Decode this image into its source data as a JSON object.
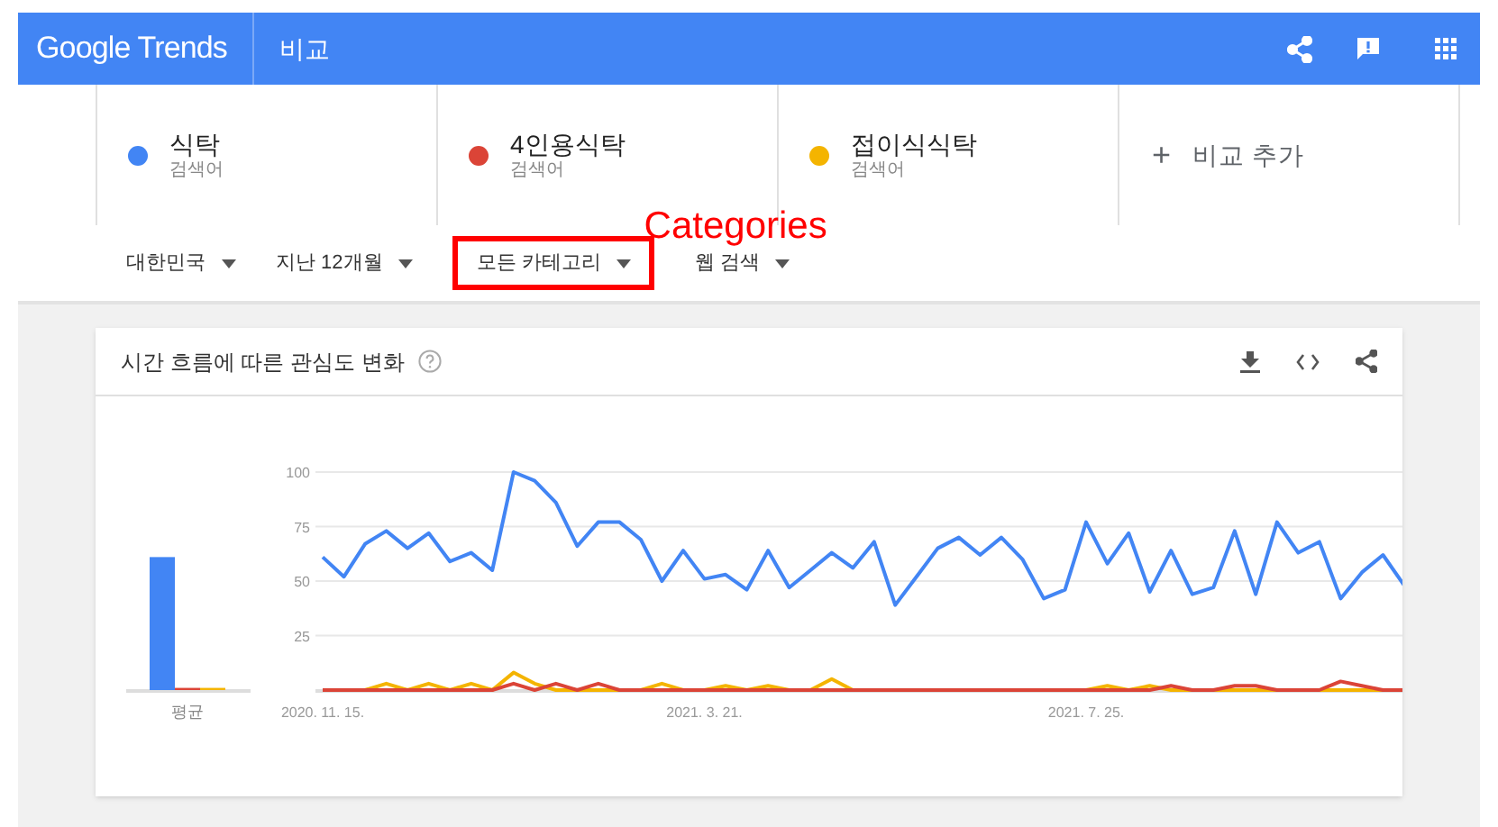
{
  "app_bar": {
    "logo": "Google Trends",
    "title": "비교"
  },
  "terms": [
    {
      "name": "식탁",
      "type": "검색어",
      "color": "#4285f4"
    },
    {
      "name": "4인용식탁",
      "type": "검색어",
      "color": "#db4437"
    },
    {
      "name": "접이식식탁",
      "type": "검색어",
      "color": "#f4b400"
    }
  ],
  "add_compare": {
    "icon": "+",
    "label": "비교 추가"
  },
  "filters": [
    {
      "label": "대한민국",
      "highlighted": false
    },
    {
      "label": "지난 12개월",
      "highlighted": false
    },
    {
      "label": "모든 카테고리",
      "highlighted": true
    },
    {
      "label": "웹 검색",
      "highlighted": false
    }
  ],
  "annotation": {
    "label": "Categories"
  },
  "interest_card": {
    "title": "시간 흐름에 따른 관심도 변화",
    "average_chart": {
      "chart_data": {
        "type": "bar",
        "categories": [
          "평균"
        ],
        "ylim": [
          0,
          100
        ],
        "series": [
          {
            "color": "#4285f4",
            "values": [
              61
            ]
          },
          {
            "color": "#db4437",
            "values": [
              1
            ]
          },
          {
            "color": "#f4b400",
            "values": [
              1
            ]
          }
        ]
      }
    },
    "trend_chart": {
      "chart_data": {
        "type": "line",
        "categories": [
          "2020. 11. 15.",
          null,
          null,
          null,
          null,
          null,
          null,
          null,
          null,
          null,
          null,
          null,
          null,
          null,
          null,
          null,
          null,
          null,
          "2021. 3. 21.",
          null,
          null,
          null,
          null,
          null,
          null,
          null,
          null,
          null,
          null,
          null,
          null,
          null,
          null,
          null,
          null,
          null,
          "2021. 7. 25.",
          null,
          null,
          null,
          null,
          null,
          null,
          null,
          null,
          null,
          null,
          null,
          null,
          null,
          null,
          null
        ],
        "ylim": [
          0,
          100
        ],
        "yticks": [
          25,
          50,
          75,
          100
        ],
        "grid": true,
        "series": [
          {
            "color": "#4285f4",
            "values": [
              61,
              52,
              67,
              73,
              65,
              72,
              59,
              63,
              55,
              100,
              96,
              86,
              66,
              77,
              77,
              69,
              50,
              64,
              51,
              53,
              46,
              64,
              47,
              55,
              63,
              56,
              68,
              39,
              52,
              65,
              70,
              62,
              70,
              60,
              42,
              46,
              77,
              58,
              72,
              45,
              64,
              44,
              47,
              73,
              44,
              77,
              63,
              68,
              42,
              54,
              62,
              48
            ]
          },
          {
            "color": "#db4437",
            "values": [
              0,
              0,
              0,
              0,
              0,
              0,
              0,
              0,
              0,
              3,
              0,
              3,
              0,
              3,
              0,
              0,
              0,
              0,
              0,
              0,
              0,
              0,
              0,
              0,
              0,
              0,
              0,
              0,
              0,
              0,
              0,
              0,
              0,
              0,
              0,
              0,
              0,
              0,
              0,
              0,
              2,
              0,
              0,
              2,
              2,
              0,
              0,
              0,
              4,
              2,
              0,
              0
            ]
          },
          {
            "color": "#f4b400",
            "values": [
              0,
              0,
              0,
              3,
              0,
              3,
              0,
              3,
              0,
              8,
              3,
              0,
              0,
              0,
              0,
              0,
              3,
              0,
              0,
              2,
              0,
              2,
              0,
              0,
              5,
              0,
              0,
              0,
              0,
              0,
              0,
              0,
              0,
              0,
              0,
              0,
              0,
              2,
              0,
              2,
              0,
              0,
              0,
              0,
              0,
              0,
              0,
              0,
              0,
              0,
              0,
              0
            ]
          }
        ]
      }
    }
  }
}
